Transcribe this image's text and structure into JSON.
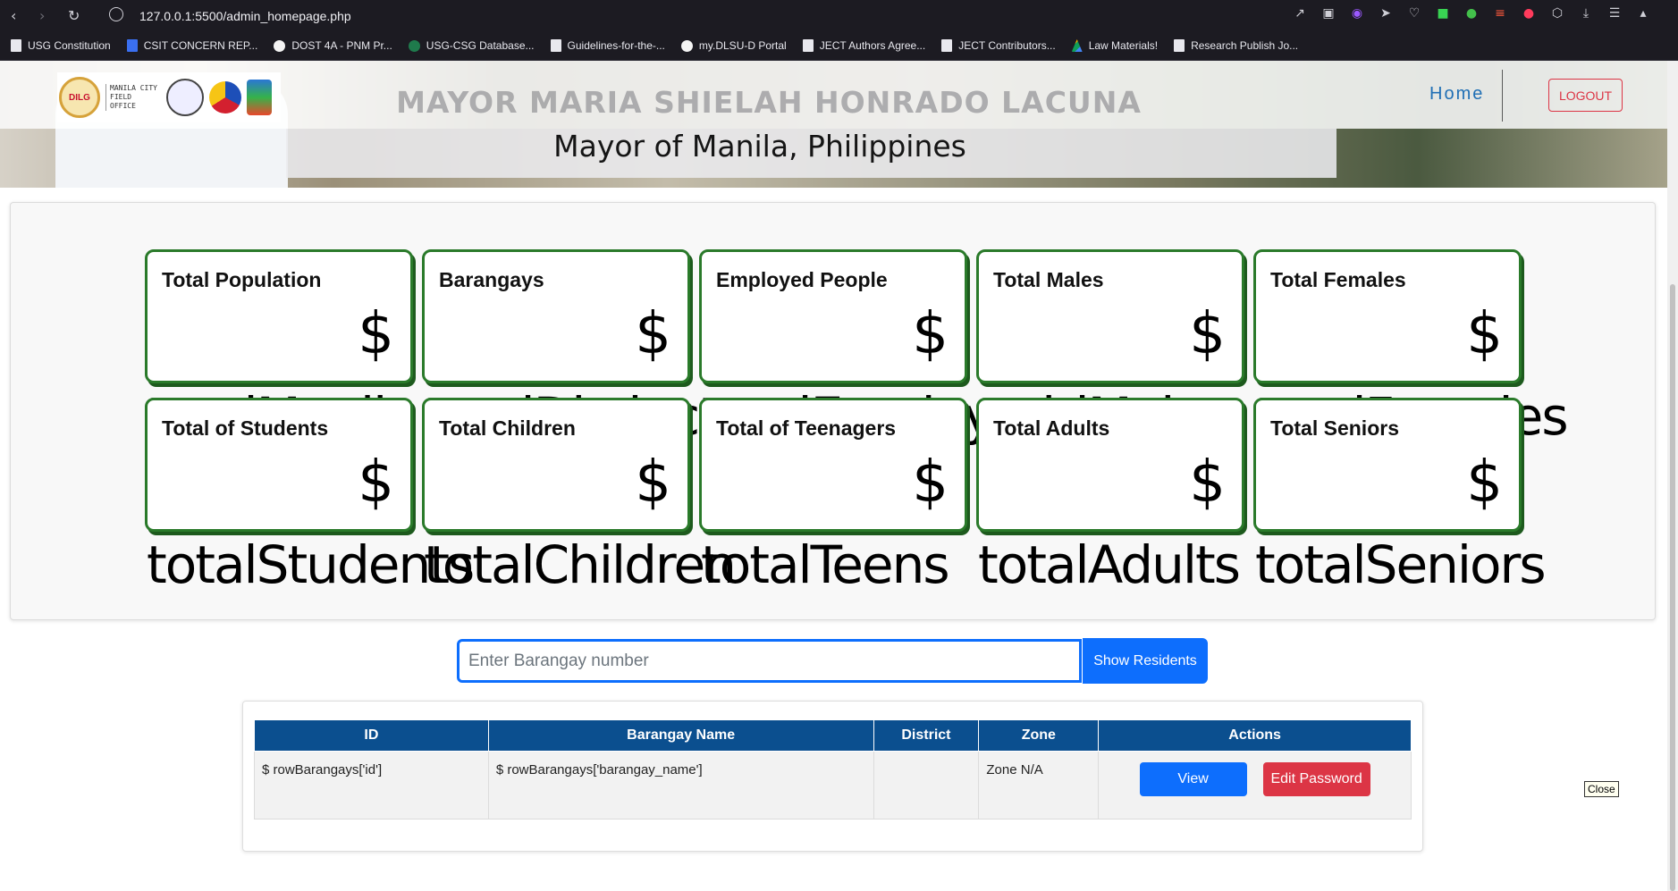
{
  "browser": {
    "url": "127.0.0.1:5500/admin_homepage.php",
    "bookmarks": [
      "USG Constitution",
      "CSIT CONCERN REP...",
      "DOST 4A - PNM Pr...",
      "USG-CSG Database...",
      "Guidelines-for-the-...",
      "my.DLSU-D Portal",
      "JECT Authors Agree...",
      "JECT Contributors...",
      "Law Materials!",
      "Research Publish Jo..."
    ]
  },
  "header": {
    "logo_seal_text": "DILG",
    "logo_office_text": "MANILA CITY FIELD OFFICE",
    "banner_title": "MAYOR MARIA SHIELAH HONRADO LACUNA",
    "banner_subtitle": "Mayor of Manila, Philippines",
    "home_label": "Home",
    "logout_label": "LOGOUT"
  },
  "stats": {
    "currency_symbol": "$",
    "cards": [
      {
        "title": "Total Population",
        "var": "totalManila"
      },
      {
        "title": "Barangays",
        "var": "totalDistinct"
      },
      {
        "title": "Employed People",
        "var": "totalEmployed"
      },
      {
        "title": "Total Males",
        "var": "totalMales"
      },
      {
        "title": "Total Females",
        "var": "totalFemales"
      },
      {
        "title": "Total of Students",
        "var": "totalStudents"
      },
      {
        "title": "Total Children",
        "var": "totalChildren"
      },
      {
        "title": "Total of Teenagers",
        "var": "totalTeens"
      },
      {
        "title": "Total Adults",
        "var": "totalAdults"
      },
      {
        "title": "Total Seniors",
        "var": "totalSeniors"
      }
    ]
  },
  "search": {
    "placeholder": "Enter Barangay number",
    "button_label": "Show Residents"
  },
  "table": {
    "headers": [
      "ID",
      "Barangay Name",
      "District",
      "Zone",
      "Actions"
    ],
    "rows": [
      {
        "id": "$ rowBarangays['id']",
        "name": "$ rowBarangays['barangay_name']",
        "district": "",
        "zone": "Zone N/A",
        "view_label": "View",
        "edit_label": "Edit Password"
      }
    ]
  },
  "tooltip": {
    "close_label": "Close"
  }
}
